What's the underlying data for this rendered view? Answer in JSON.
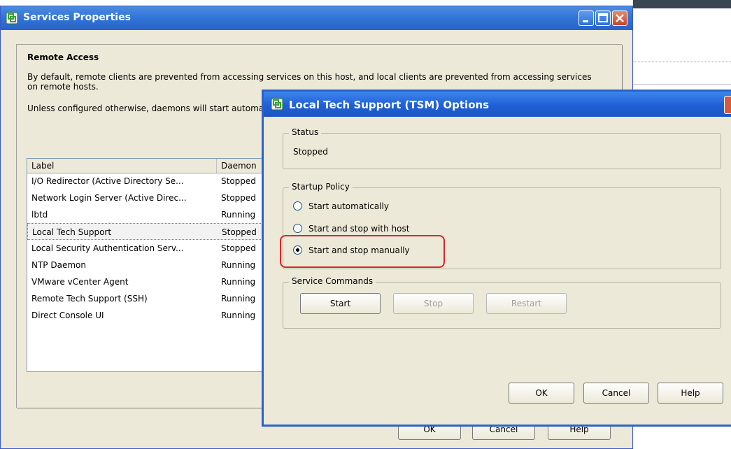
{
  "main_window": {
    "title": "Services Properties",
    "section_title": "Remote Access",
    "description_1": "By default, remote clients are prevented from accessing services on this host, and local clients are prevented from accessing services on remote hosts.",
    "description_2": "Unless configured otherwise, daemons will start automatically",
    "columns": [
      "Label",
      "Daemon"
    ],
    "rows": [
      {
        "label": "I/O Redirector (Active Directory Se...",
        "daemon": "Stopped"
      },
      {
        "label": "Network Login Server (Active Direc...",
        "daemon": "Stopped"
      },
      {
        "label": "lbtd",
        "daemon": "Running"
      },
      {
        "label": "Local Tech Support",
        "daemon": "Stopped"
      },
      {
        "label": "Local Security Authentication Serv...",
        "daemon": "Stopped"
      },
      {
        "label": "NTP Daemon",
        "daemon": "Running"
      },
      {
        "label": "VMware vCenter Agent",
        "daemon": "Running"
      },
      {
        "label": "Remote Tech Support (SSH)",
        "daemon": "Running"
      },
      {
        "label": "Direct Console UI",
        "daemon": "Running"
      }
    ],
    "selected_row": 3,
    "buttons": {
      "ok": "OK",
      "cancel": "Cancel",
      "help": "Help"
    }
  },
  "tsm_dialog": {
    "title": "Local Tech Support (TSM) Options",
    "status_legend": "Status",
    "status_value": "Stopped",
    "startup_legend": "Startup Policy",
    "startup_options": [
      {
        "label": "Start automatically",
        "selected": false
      },
      {
        "label": "Start and stop with host",
        "selected": false
      },
      {
        "label": "Start and stop manually",
        "selected": true
      }
    ],
    "commands_legend": "Service Commands",
    "commands": {
      "start": "Start",
      "stop": "Stop",
      "restart": "Restart"
    },
    "buttons": {
      "ok": "OK",
      "cancel": "Cancel",
      "help": "Help"
    }
  },
  "colors": {
    "titlebar": "#2a63c8",
    "dialog_bg": "#ece9d8",
    "highlight": "#d9262a"
  }
}
